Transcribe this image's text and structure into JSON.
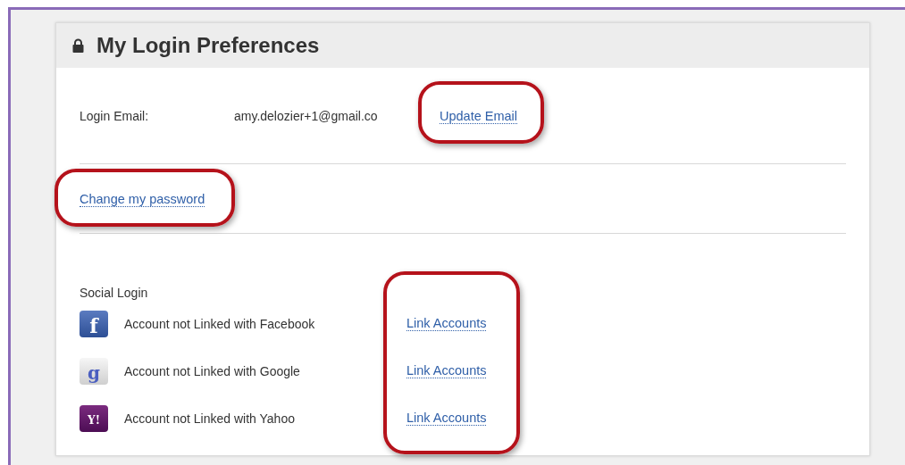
{
  "panel": {
    "title": "My Login Preferences"
  },
  "email": {
    "label": "Login Email:",
    "value": "amy.delozier+1@gmail.co",
    "link": {
      "label": "Update Email",
      "highlighted": true
    }
  },
  "password_link": {
    "label": "Change my password",
    "highlighted": true
  },
  "social": {
    "title": "Social Login",
    "highlighted": true,
    "accounts": [
      {
        "kind": "facebook",
        "glyph": "f",
        "status": "Account not Linked with Facebook",
        "link": "Link Accounts"
      },
      {
        "kind": "google",
        "glyph": "g",
        "status": "Account not Linked with Google",
        "link": "Link Accounts"
      },
      {
        "kind": "yahoo",
        "glyph": "Y!",
        "status": "Account not Linked with Yahoo",
        "link": "Link Accounts"
      }
    ]
  }
}
